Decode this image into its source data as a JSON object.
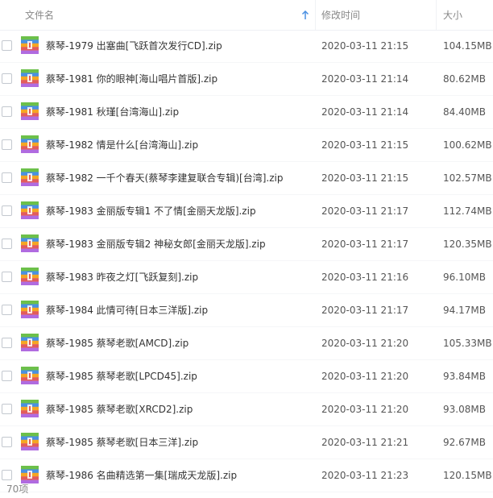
{
  "header": {
    "name_label": "文件名",
    "time_label": "修改时间",
    "size_label": "大小",
    "sort_icon": "arrow-up-icon"
  },
  "colors": {
    "header_text": "#888888",
    "sort_arrow": "#4a90e2",
    "zip_bands": [
      "#6cc04a",
      "#4a90e2",
      "#f5a623",
      "#e25c5c",
      "#b06be0"
    ]
  },
  "files": [
    {
      "name": "蔡琴-1979 出塞曲[飞跃首次发行CD].zip",
      "time": "2020-03-11 21:15",
      "size": "104.15MB",
      "icon": "zip-archive-icon"
    },
    {
      "name": "蔡琴-1981 你的眼神[海山唱片首版].zip",
      "time": "2020-03-11 21:14",
      "size": "80.62MB",
      "icon": "zip-archive-icon"
    },
    {
      "name": "蔡琴-1981 秋瑾[台湾海山].zip",
      "time": "2020-03-11 21:14",
      "size": "84.40MB",
      "icon": "zip-archive-icon"
    },
    {
      "name": "蔡琴-1982 情是什么[台湾海山].zip",
      "time": "2020-03-11 21:15",
      "size": "100.62MB",
      "icon": "zip-archive-icon"
    },
    {
      "name": "蔡琴-1982 一千个春天(蔡琴李建复联合专辑)[台湾].zip",
      "time": "2020-03-11 21:15",
      "size": "102.57MB",
      "icon": "zip-archive-icon"
    },
    {
      "name": "蔡琴-1983 金丽版专辑1 不了情[金丽天龙版].zip",
      "time": "2020-03-11 21:17",
      "size": "112.74MB",
      "icon": "zip-archive-icon"
    },
    {
      "name": "蔡琴-1983 金丽版专辑2 神秘女郎[金丽天龙版].zip",
      "time": "2020-03-11 21:17",
      "size": "120.35MB",
      "icon": "zip-archive-icon"
    },
    {
      "name": "蔡琴-1983 昨夜之灯[飞跃复刻].zip",
      "time": "2020-03-11 21:16",
      "size": "96.10MB",
      "icon": "zip-archive-icon"
    },
    {
      "name": "蔡琴-1984 此情可待[日本三洋版].zip",
      "time": "2020-03-11 21:17",
      "size": "94.17MB",
      "icon": "zip-archive-icon"
    },
    {
      "name": "蔡琴-1985 蔡琴老歌[AMCD].zip",
      "time": "2020-03-11 21:20",
      "size": "105.33MB",
      "icon": "zip-archive-icon"
    },
    {
      "name": "蔡琴-1985 蔡琴老歌[LPCD45].zip",
      "time": "2020-03-11 21:20",
      "size": "93.84MB",
      "icon": "zip-archive-icon"
    },
    {
      "name": "蔡琴-1985 蔡琴老歌[XRCD2].zip",
      "time": "2020-03-11 21:20",
      "size": "93.08MB",
      "icon": "zip-archive-icon"
    },
    {
      "name": "蔡琴-1985 蔡琴老歌[日本三洋].zip",
      "time": "2020-03-11 21:21",
      "size": "92.67MB",
      "icon": "zip-archive-icon"
    },
    {
      "name": "蔡琴-1986 名曲精选第一集[瑞成天龙版].zip",
      "time": "2020-03-11 21:23",
      "size": "120.15MB",
      "icon": "zip-archive-icon"
    }
  ],
  "footer": {
    "item_count": "70项"
  }
}
